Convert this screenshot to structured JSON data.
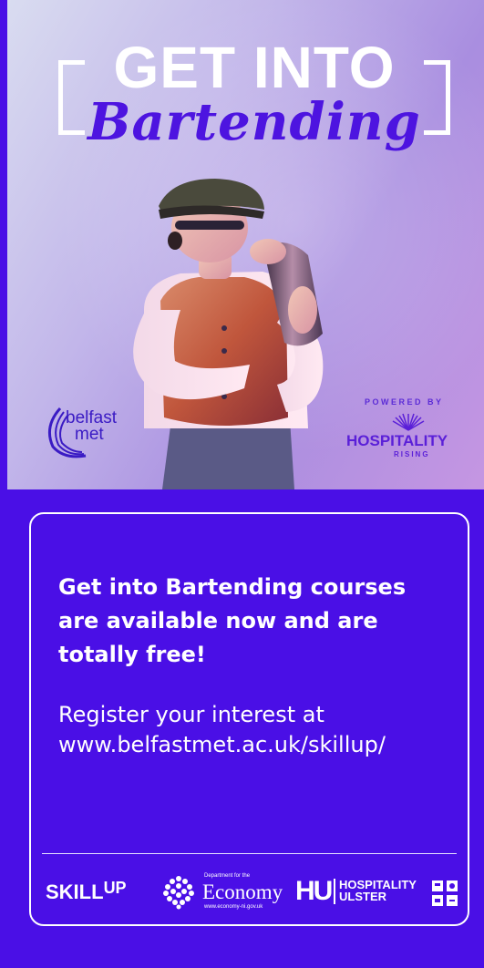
{
  "hero": {
    "title_top": "GET INTO",
    "title_script": "Bartending",
    "college_logo": {
      "line1": "belfast",
      "line2": "met"
    },
    "powered_by": "POWERED BY",
    "partner_logo": {
      "name": "HOSPITALITY",
      "sub": "RISING"
    }
  },
  "card": {
    "headline": "Get into Bartending courses are available now and are totally free!",
    "register_line1": "Register your interest at",
    "register_url": "www.belfastmet.ac.uk/skillup/"
  },
  "footer_logos": {
    "skillup_main": "SKILL",
    "skillup_up": "UP",
    "economy_dept": "Department for the",
    "economy_name": "Economy",
    "economy_url": "www.economy-ni.gov.uk",
    "hu_mark": "HU",
    "hu_line1": "HOSPITALITY",
    "hu_line2": "ULSTER"
  },
  "colors": {
    "brand_purple": "#4a0fe6",
    "script_purple": "#4d14e0",
    "card_border": "#ffffff"
  }
}
